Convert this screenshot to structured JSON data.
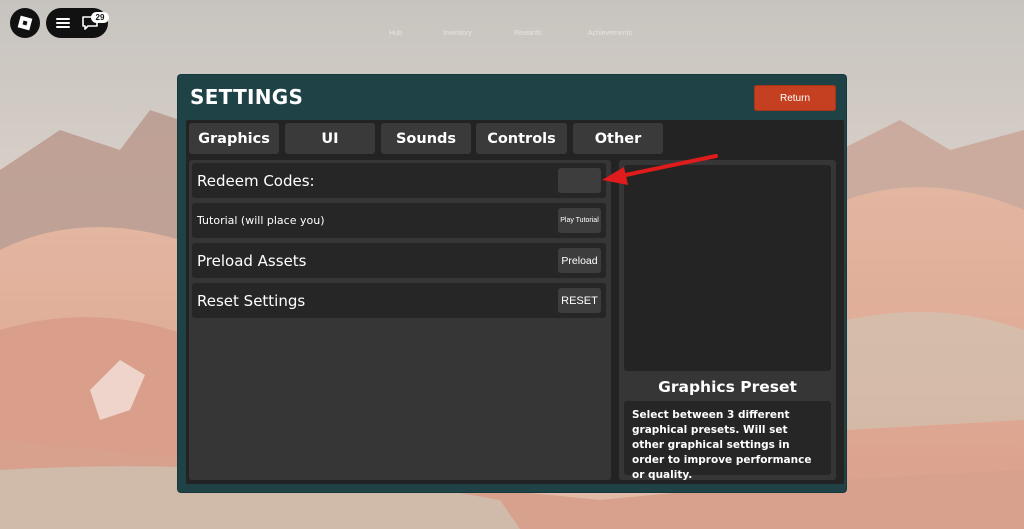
{
  "topbar": {
    "notification_count": "29",
    "faint_labels": [
      "Hub",
      "Inventory",
      "Rewards",
      "Achievements"
    ]
  },
  "settings": {
    "title": "SETTINGS",
    "return_label": "Return",
    "tabs": [
      {
        "label": "Graphics"
      },
      {
        "label": "UI"
      },
      {
        "label": "Sounds"
      },
      {
        "label": "Controls"
      },
      {
        "label": "Other"
      }
    ],
    "rows": [
      {
        "label": "Redeem Codes:",
        "button_label": ""
      },
      {
        "label": "Tutorial (will place you)",
        "button_label": "Play Tutorial"
      },
      {
        "label": "Preload Assets",
        "button_label": "Preload"
      },
      {
        "label": "Reset Settings",
        "button_label": "RESET"
      }
    ],
    "preset": {
      "title": "Graphics Preset",
      "description": "Select between 3 different graphical presets. Will set other graphical settings in order to improve performance or quality."
    }
  },
  "colors": {
    "window_frame": "#1f4247",
    "return_button": "#c53f21",
    "panel_dark": "#232323",
    "annotation_arrow": "#e01b1b"
  }
}
